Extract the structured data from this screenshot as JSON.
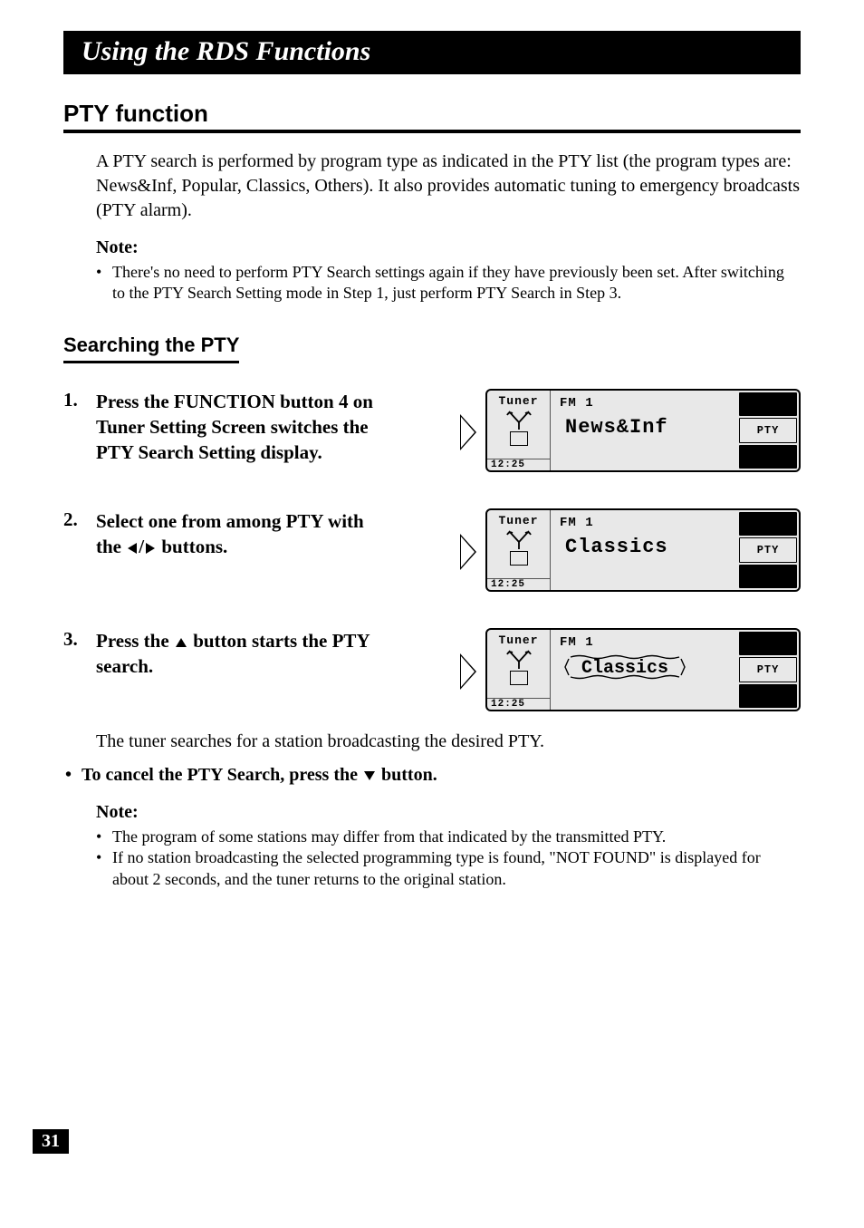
{
  "title": "Using the RDS Functions",
  "section1": {
    "heading": "PTY function",
    "para": "A PTY search is performed by program type as indicated in the PTY list (the program types are: News&Inf, Popular, Classics, Others). It also provides automatic tuning to emergency broadcasts (PTY alarm).",
    "noteLabel": "Note:",
    "noteItem": "There's no need to perform PTY Search settings again if they have previously been set. After switching to the PTY Search Setting mode in Step 1, just perform PTY Search in Step 3."
  },
  "section2": {
    "heading": "Searching the PTY",
    "steps": [
      {
        "num": "1.",
        "text": "Press the FUNCTION button 4 on Tuner Setting Screen switches the PTY Search Setting display.",
        "screen": {
          "tuner": "Tuner",
          "fm": "FM 1",
          "pty": "News&Inf",
          "time": "12:25",
          "btn": "PTY",
          "dashed": false
        }
      },
      {
        "num": "2.",
        "textPre": "Select one from among PTY with the ",
        "textPost": " buttons.",
        "arrows": "lr",
        "screen": {
          "tuner": "Tuner",
          "fm": "FM 1",
          "pty": "Classics",
          "time": "12:25",
          "btn": "PTY",
          "dashed": false
        }
      },
      {
        "num": "3.",
        "textPre": "Press the ",
        "textPost": " button starts the PTY search.",
        "arrows": "u",
        "screen": {
          "tuner": "Tuner",
          "fm": "FM 1",
          "pty": "Classics",
          "time": "12:25",
          "btn": "PTY",
          "dashed": true
        }
      }
    ],
    "afterSteps": "The tuner searches for a station broadcasting the desired PTY.",
    "cancelPre": "To cancel the PTY Search, press the ",
    "cancelPost": " button.",
    "note2Label": "Note:",
    "note2Items": [
      "The program of some stations may differ from that indicated by the transmitted PTY.",
      "If no station broadcasting the selected programming type is found, \"NOT FOUND\" is displayed for about 2 seconds, and the tuner returns to the original station."
    ]
  },
  "pageNumber": "31"
}
